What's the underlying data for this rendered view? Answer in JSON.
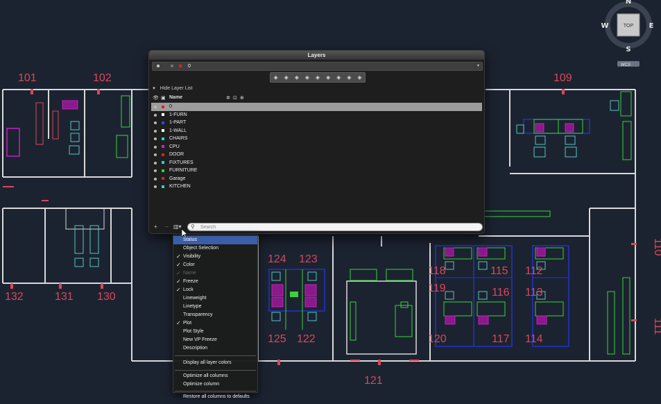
{
  "colors": {
    "background": "#1c2330",
    "wall": "#d9d9d9",
    "accent_red": "#d8485a",
    "furniture_green": "#36d43a",
    "chair_cyan": "#56c4c4",
    "workstation_blue": "#2233cc",
    "magenta": "#c41ec4"
  },
  "viewcube": {
    "top_label": "TOP",
    "north": "N",
    "south": "S",
    "east": "E",
    "west": "W",
    "wcs_label": "WCS"
  },
  "room_numbers": {
    "r101": "101",
    "r102": "102",
    "r109": "109",
    "r110": "110",
    "r111": "111",
    "r112": "112",
    "r113": "113",
    "r114": "114",
    "r115": "115",
    "r116": "116",
    "r117": "117",
    "r118": "118",
    "r119": "119",
    "r120": "120",
    "r121": "121",
    "r122": "122",
    "r123": "123",
    "r124": "124",
    "r125": "125",
    "r130": "130",
    "r131": "131",
    "r132": "132"
  },
  "layers_panel": {
    "title": "Layers",
    "current_layer": "0",
    "toolbar_icons": [
      "new-layer-icon",
      "new-vp-frozen-icon",
      "delete-layer-icon",
      "set-current-icon",
      "layer-states-icon",
      "isolate-icon",
      "unisolate-icon",
      "merge-icon",
      "walk-icon"
    ],
    "hide_list_label": "Hide Layer List",
    "column_name": "Name",
    "layers": [
      {
        "name": "0",
        "color": "#e02020",
        "selected": true
      },
      {
        "name": "1-FURN",
        "color": "#ffffff",
        "selected": false
      },
      {
        "name": "1-PART",
        "color": "#3344ff",
        "selected": false
      },
      {
        "name": "1-WALL",
        "color": "#ffffff",
        "selected": false
      },
      {
        "name": "CHAIRS",
        "color": "#30d0d0",
        "selected": false
      },
      {
        "name": "CPU",
        "color": "#d020d0",
        "selected": false
      },
      {
        "name": "DOOR",
        "color": "#e02020",
        "selected": false
      },
      {
        "name": "FIXTURES",
        "color": "#30d0d0",
        "selected": false
      },
      {
        "name": "FURNITURE",
        "color": "#30d030",
        "selected": false
      },
      {
        "name": "Garage",
        "color": "#e02020",
        "selected": false
      },
      {
        "name": "KITCHEN",
        "color": "#30d0d0",
        "selected": false
      }
    ],
    "add_symbol": "+",
    "remove_symbol": "−",
    "search_placeholder": "Search"
  },
  "context_menu": {
    "items": [
      {
        "label": "Status",
        "checked": false,
        "highlighted": true,
        "disabled": false
      },
      {
        "label": "Object Selection",
        "checked": false,
        "highlighted": false,
        "disabled": false
      },
      {
        "label": "Visibility",
        "checked": true,
        "highlighted": false,
        "disabled": false
      },
      {
        "label": "Color",
        "checked": true,
        "highlighted": false,
        "disabled": false
      },
      {
        "label": "Name",
        "checked": true,
        "highlighted": false,
        "disabled": true
      },
      {
        "label": "Freeze",
        "checked": true,
        "highlighted": false,
        "disabled": false
      },
      {
        "label": "Lock",
        "checked": true,
        "highlighted": false,
        "disabled": false
      },
      {
        "label": "Lineweight",
        "checked": false,
        "highlighted": false,
        "disabled": false
      },
      {
        "label": "Linetype",
        "checked": false,
        "highlighted": false,
        "disabled": false
      },
      {
        "label": "Transparency",
        "checked": false,
        "highlighted": false,
        "disabled": false
      },
      {
        "label": "Plot",
        "checked": true,
        "highlighted": false,
        "disabled": false
      },
      {
        "label": "Plot Style",
        "checked": false,
        "highlighted": false,
        "disabled": false
      },
      {
        "label": "New VP Freeze",
        "checked": false,
        "highlighted": false,
        "disabled": false
      },
      {
        "label": "Description",
        "checked": false,
        "highlighted": false,
        "disabled": false
      }
    ],
    "display_all_colors": "Display all layer colors",
    "optimize_all": "Optimize all columns",
    "optimize_column": "Optimize column",
    "restore_defaults": "Restore all columns to defaults",
    "checkmark": "✓"
  }
}
